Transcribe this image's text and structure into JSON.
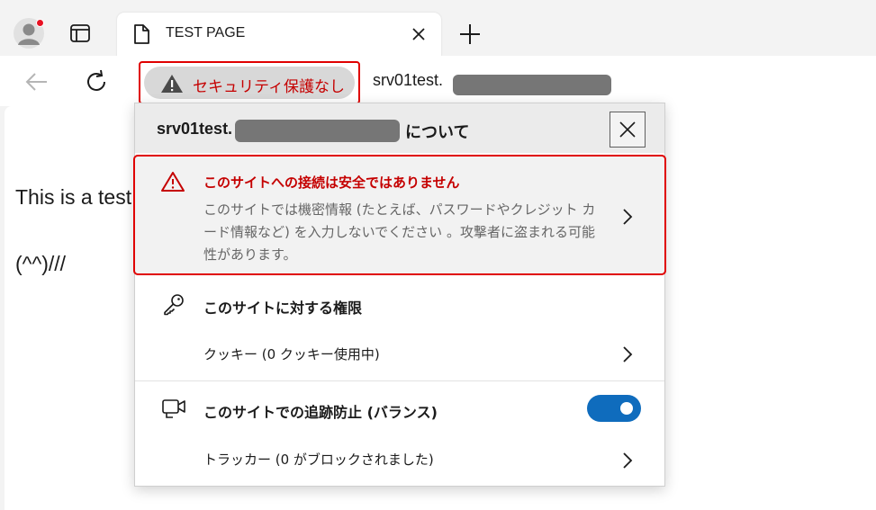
{
  "tab": {
    "title": "TEST PAGE"
  },
  "address": {
    "security_label": "セキュリティ保護なし",
    "url_prefix": "srv01test."
  },
  "page": {
    "line1": "This is a test",
    "line2": "(^^)///"
  },
  "popup": {
    "site_prefix": "srv01test.",
    "about_suffix": "について",
    "warning": {
      "title": "このサイトへの接続は安全ではありません",
      "body": "このサイトでは機密情報 (たとえば、パスワードやクレジット カード情報など) を入力しないでください 。攻撃者に盗まれる可能性があります。"
    },
    "permissions": {
      "title": "このサイトに対する権限",
      "cookies_label": "クッキー (0 クッキー使用中)"
    },
    "tracking": {
      "title": "このサイトでの追跡防止 (バランス)",
      "enabled": true,
      "trackers_label": "トラッカー (0 がブロックされました)"
    }
  },
  "colors": {
    "alert_red": "#c50000",
    "highlight_border": "#e00000",
    "toggle_blue": "#0f6cbd",
    "redaction_gray": "#767676"
  },
  "icons": [
    "profile-icon",
    "tab-actions-icon",
    "document-icon",
    "close-icon",
    "plus-icon",
    "back-arrow-icon",
    "refresh-icon",
    "warning-icon",
    "chevron-right-icon",
    "key-icon",
    "camera-tracking-icon"
  ]
}
